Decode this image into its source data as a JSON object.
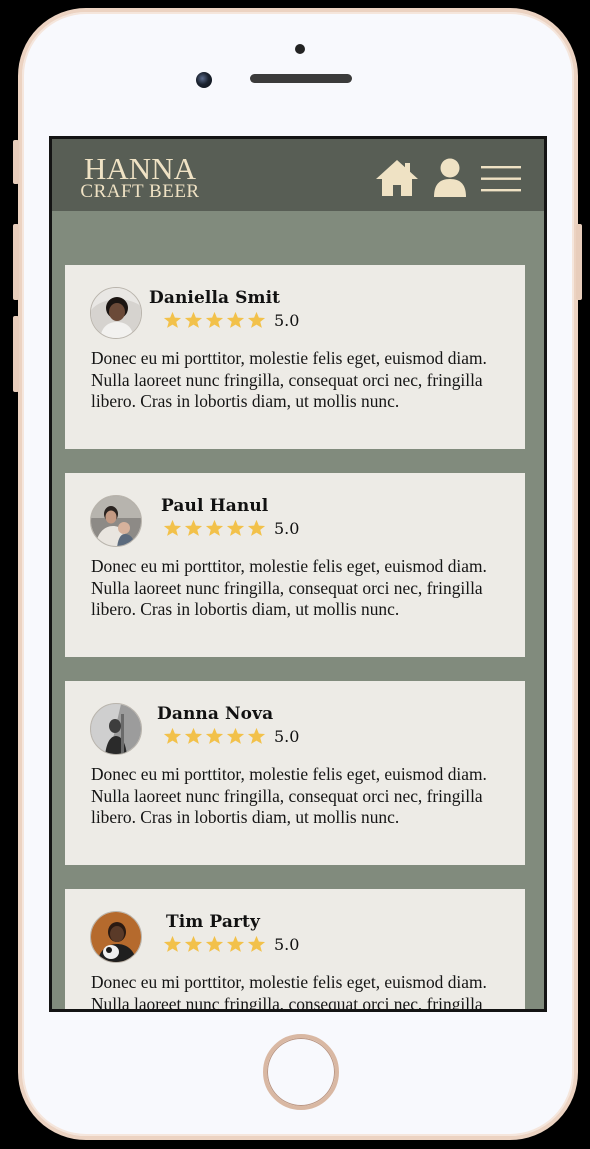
{
  "brand": {
    "name_line1": "HANNA",
    "name_line2": "CRAFT BEER"
  },
  "nav": {
    "icons": [
      "home-icon",
      "user-icon",
      "menu-icon"
    ]
  },
  "colors": {
    "header_bg": "#585e55",
    "page_bg": "#818b7d",
    "card_bg": "#edebe6",
    "star": "#f2c14a",
    "logo": "#efe2c4",
    "device_frame": "#ecd3c2"
  },
  "reviews": [
    {
      "name": "Daniella Smit",
      "stars": 5,
      "rating": "5.0",
      "text": "Donec eu mi porttitor, molestie felis eget, euismod diam. Nulla laoreet nunc fringilla, consequat orci nec, fringilla libero. Cras in lobortis diam, ut mollis nunc."
    },
    {
      "name": "Paul Hanul",
      "stars": 5,
      "rating": "5.0",
      "text": "Donec eu mi porttitor, molestie felis eget, euismod diam. Nulla laoreet nunc fringilla, consequat orci nec, fringilla libero. Cras in lobortis diam, ut mollis nunc."
    },
    {
      "name": "Danna Nova",
      "stars": 5,
      "rating": "5.0",
      "text": "Donec eu mi porttitor, molestie felis eget, euismod diam. Nulla laoreet nunc fringilla, consequat orci nec, fringilla libero. Cras in lobortis diam, ut mollis nunc."
    },
    {
      "name": "Tim Party",
      "stars": 5,
      "rating": "5.0",
      "text": "Donec eu mi porttitor, molestie felis eget, euismod diam. Nulla laoreet nunc fringilla, consequat orci nec, fringilla libero. Cras in lobortis diam, ut mollis nunc."
    }
  ]
}
